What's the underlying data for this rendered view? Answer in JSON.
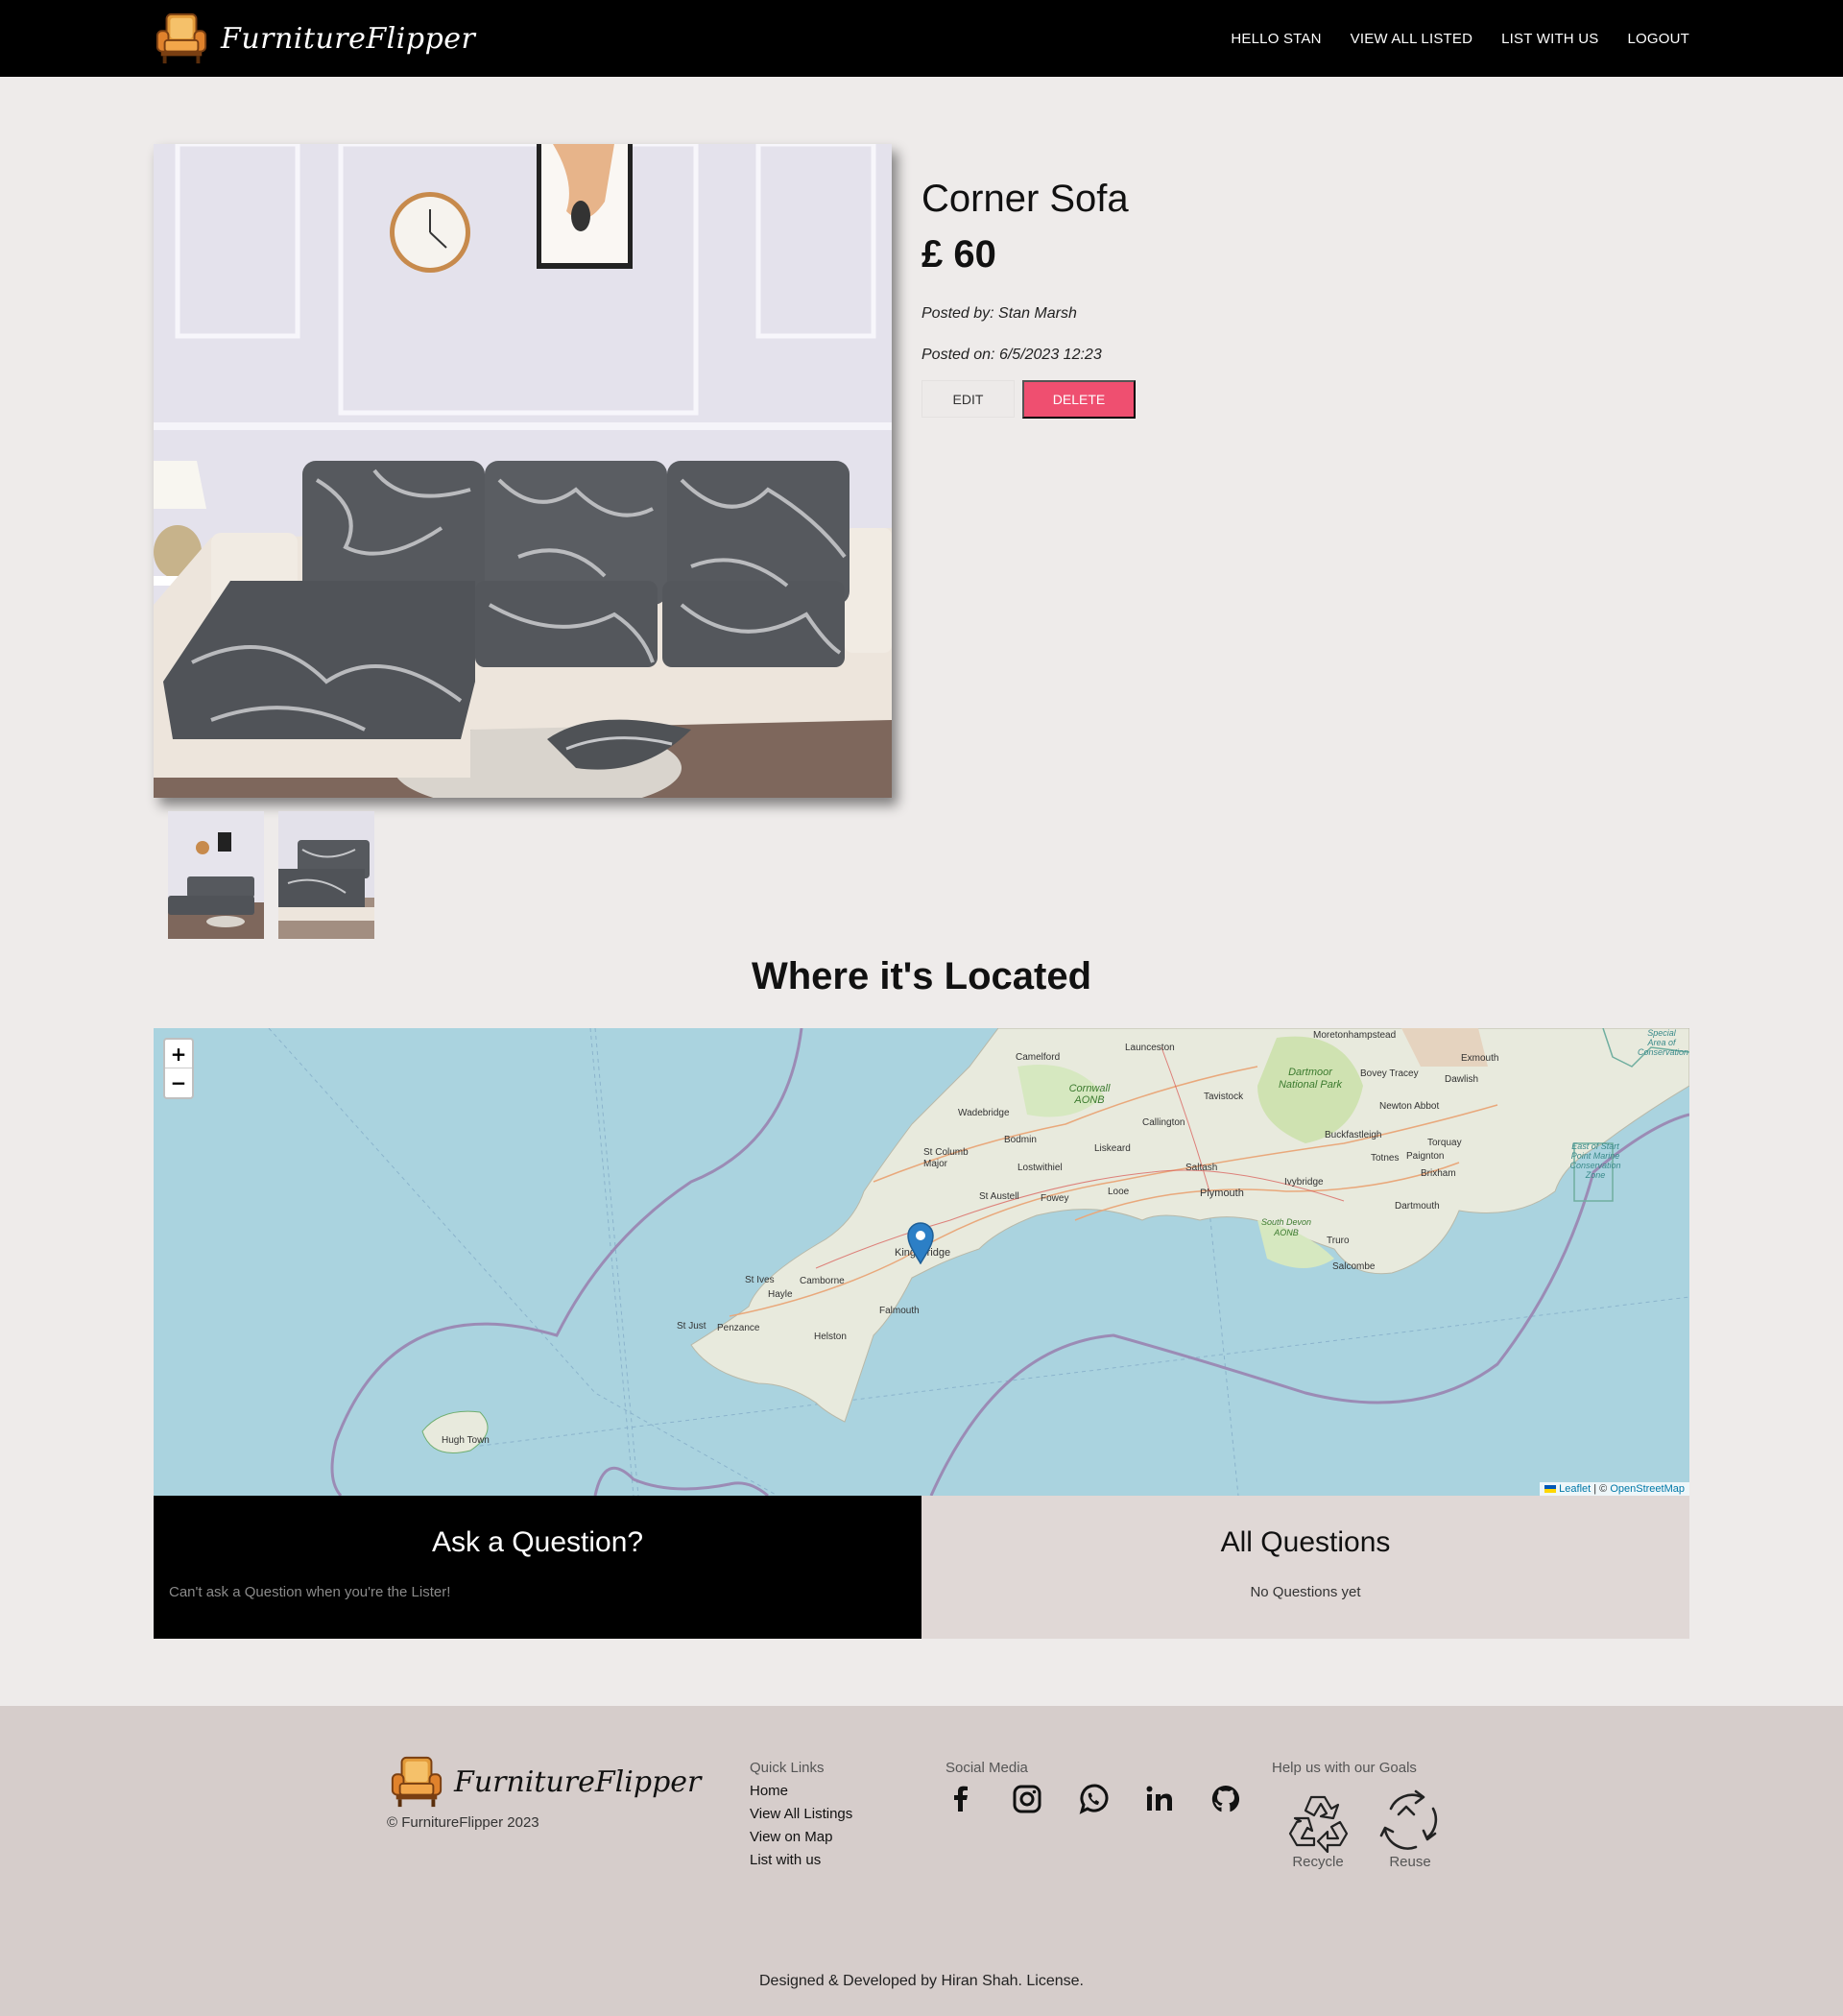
{
  "nav": {
    "brand": "FurnitureFlipper",
    "links": [
      "HELLO STAN",
      "VIEW ALL LISTED",
      "LIST WITH US",
      "LOGOUT"
    ]
  },
  "listing": {
    "title": "Corner Sofa",
    "price": "£ 60",
    "posted_by": "Posted by: Stan Marsh",
    "posted_on": "Posted on: 6/5/2023 12:23",
    "edit_label": "EDIT",
    "delete_label": "DELETE",
    "thumbnail_count": 2
  },
  "location": {
    "heading": "Where it's Located",
    "zoom_in": "+",
    "zoom_out": "−",
    "attribution_leaflet": "Leaflet",
    "attribution_sep": " | © ",
    "attribution_osm": "OpenStreetMap",
    "places": [
      "Moretonhampstead",
      "Launceston",
      "Camelford",
      "Cornwall AONB",
      "Dartmoor National Park",
      "Bovey Tracey",
      "Exmouth",
      "Dawlish",
      "Tavistock",
      "Wadebridge",
      "Newton Abbot",
      "Bodmin",
      "Callington",
      "Buckfastleigh",
      "Torquay",
      "St Columb Major",
      "Liskeard",
      "Totnes",
      "Paignton",
      "Lostwithiel",
      "Saltash",
      "Ivybridge",
      "Brixham",
      "Plymouth",
      "St Austell",
      "Fowey",
      "Looe",
      "Dartmouth",
      "South Devon AONB",
      "Kingsbridge",
      "Truro",
      "Salcombe",
      "St Ives",
      "Camborne",
      "Hayle",
      "Falmouth",
      "St Just",
      "Penzance",
      "Helston",
      "Hugh Town",
      "Special Area of Conservation",
      "East of Start Point Marine Conservation Zone"
    ]
  },
  "questions": {
    "ask_title": "Ask a Question?",
    "ask_note": "Can't ask a Question when you're the Lister!",
    "all_title": "All Questions",
    "all_note": "No Questions yet"
  },
  "footer": {
    "brand": "FurnitureFlipper",
    "copyright": "© FurnitureFlipper 2023",
    "quick_links_title": "Quick Links",
    "quick_links": [
      "Home",
      "View All Listings",
      "View on Map",
      "List with us"
    ],
    "social_title": "Social Media",
    "social_icons": [
      "facebook-icon",
      "instagram-icon",
      "whatsapp-icon",
      "linkedin-icon",
      "github-icon"
    ],
    "goals_title": "Help us with our Goals",
    "goals": [
      "Recycle",
      "Reuse"
    ],
    "credit": "Designed & Developed by Hiran Shah. License."
  }
}
